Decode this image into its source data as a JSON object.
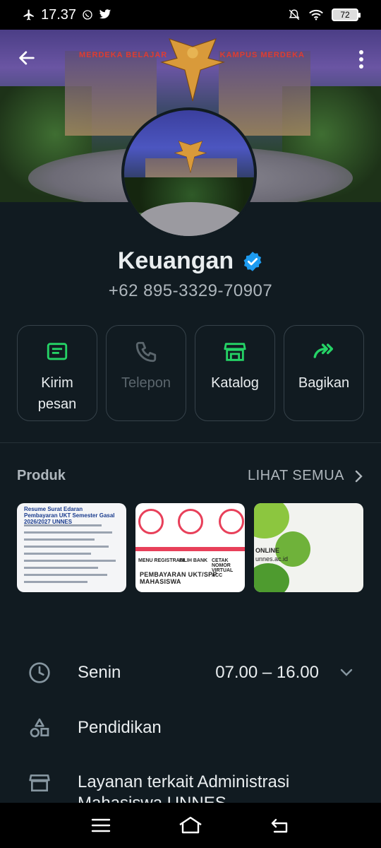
{
  "status_bar": {
    "time": "17.37",
    "battery": "72"
  },
  "profile": {
    "name": "Keuangan",
    "phone": "+62 895-3329-70907",
    "cover_banner_left": "MERDEKA BELAJAR",
    "cover_banner_right": "KAMPUS MERDEKA"
  },
  "actions": [
    {
      "label_line1": "Kirim",
      "label_line2": "pesan",
      "icon": "message-icon",
      "enabled": true
    },
    {
      "label_line1": "Telepon",
      "label_line2": "",
      "icon": "phone-icon",
      "enabled": false
    },
    {
      "label_line1": "Katalog",
      "label_line2": "",
      "icon": "store-icon",
      "enabled": true
    },
    {
      "label_line1": "Bagikan",
      "label_line2": "",
      "icon": "share-icon",
      "enabled": true
    }
  ],
  "products": {
    "title": "Produk",
    "see_all": "LIHAT SEMUA",
    "items": [
      {
        "caption": "Resume Surat Edaran Pembayaran UKT Semester Gasal 2026/2027 UNNES"
      },
      {
        "caption": "PEMBAYARAN UKT/SPP MAHASISWA",
        "steps": [
          "MENU REGISTRASI",
          "PILIH BANK",
          "CETAK NOMOR VIRTUAL ACC"
        ]
      },
      {
        "caption": "ONLINE",
        "sub": "unnes.ac.id"
      }
    ]
  },
  "info": {
    "day": "Senin",
    "hours": "07.00 – 16.00",
    "category": "Pendidikan",
    "description_line1": "Layanan terkait Administrasi",
    "description_line2": "Mahasiswa UNNES"
  },
  "colors": {
    "accent": "#25d366",
    "background": "#111b21",
    "verified": "#1d9bf0"
  }
}
